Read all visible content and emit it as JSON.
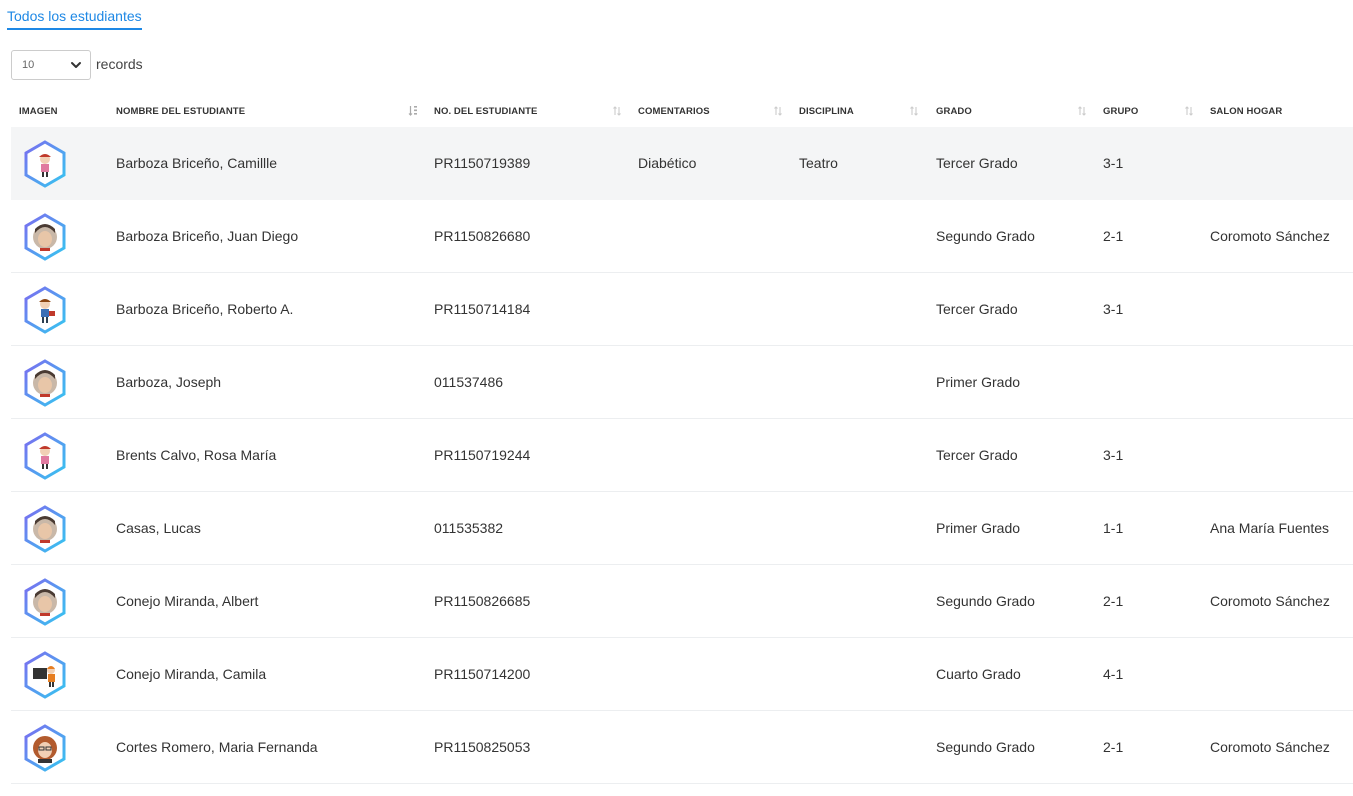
{
  "tabs": {
    "active": "Todos los estudiantes"
  },
  "page_size": {
    "value": "10",
    "label": "records"
  },
  "table": {
    "headers": {
      "image": "IMAGEN",
      "name": "NOMBRE DEL ESTUDIANTE",
      "number": "NO. DEL ESTUDIANTE",
      "comments": "COMENTARIOS",
      "discipline": "DISCIPLINA",
      "grade": "GRADO",
      "group": "GRUPO",
      "homeroom": "SALON HOGAR"
    },
    "rows": [
      {
        "name": "Barboza Briceño, Camillle",
        "number": "PR1150719389",
        "comments": "Diabético",
        "discipline": "Teatro",
        "grade": "Tercer Grado",
        "group": "3-1",
        "homeroom": "",
        "avatar_icon": "girl-student-icon"
      },
      {
        "name": "Barboza Briceño, Juan Diego",
        "number": "PR1150826680",
        "comments": "",
        "discipline": "",
        "grade": "Segundo Grado",
        "group": "2-1",
        "homeroom": "Coromoto Sánchez",
        "avatar_icon": "man-face-icon"
      },
      {
        "name": "Barboza Briceño, Roberto A.",
        "number": "PR1150714184",
        "comments": "",
        "discipline": "",
        "grade": "Tercer Grado",
        "group": "3-1",
        "homeroom": "",
        "avatar_icon": "boy-student-icon"
      },
      {
        "name": "Barboza, Joseph",
        "number": "011537486",
        "comments": "",
        "discipline": "",
        "grade": "Primer Grado",
        "group": "",
        "homeroom": "",
        "avatar_icon": "man-face-icon"
      },
      {
        "name": "Brents Calvo, Rosa María",
        "number": "PR1150719244",
        "comments": "",
        "discipline": "",
        "grade": "Tercer Grado",
        "group": "3-1",
        "homeroom": "",
        "avatar_icon": "girl-student-icon"
      },
      {
        "name": "Casas, Lucas",
        "number": "011535382",
        "comments": "",
        "discipline": "",
        "grade": "Primer Grado",
        "group": "1-1",
        "homeroom": "Ana María Fuentes",
        "avatar_icon": "man-face-icon"
      },
      {
        "name": "Conejo Miranda, Albert",
        "number": "PR1150826685",
        "comments": "",
        "discipline": "",
        "grade": "Segundo Grado",
        "group": "2-1",
        "homeroom": "Coromoto Sánchez",
        "avatar_icon": "man-face-icon"
      },
      {
        "name": "Conejo Miranda, Camila",
        "number": "PR1150714200",
        "comments": "",
        "discipline": "",
        "grade": "Cuarto Grado",
        "group": "4-1",
        "homeroom": "",
        "avatar_icon": "girl-blackboard-icon"
      },
      {
        "name": "Cortes Romero, Maria Fernanda",
        "number": "PR1150825053",
        "comments": "",
        "discipline": "",
        "grade": "Segundo Grado",
        "group": "2-1",
        "homeroom": "Coromoto Sánchez",
        "avatar_icon": "woman-face-icon"
      }
    ]
  },
  "colors": {
    "accent": "#1e88e5",
    "row_highlight": "#f4f5f6"
  }
}
